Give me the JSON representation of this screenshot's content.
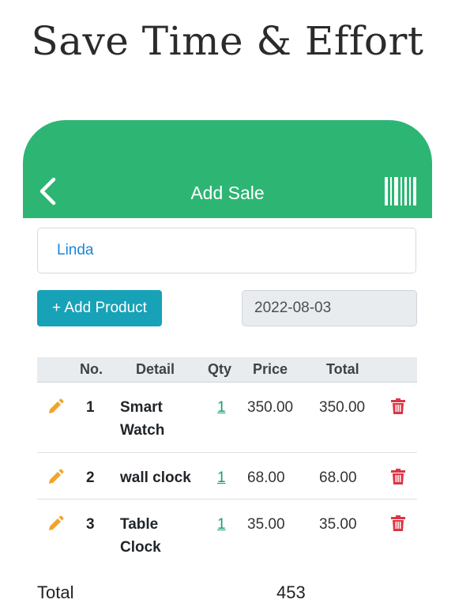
{
  "promo": {
    "headline": "Save Time & Effort"
  },
  "appbar": {
    "title": "Add Sale",
    "back_icon": "chevron-left-icon",
    "scan_icon": "barcode-icon",
    "color": "#2db574"
  },
  "form": {
    "customer": "Linda",
    "add_product_label": "+ Add Product",
    "date": "2022-08-03"
  },
  "table": {
    "headers": {
      "no": "No.",
      "detail": "Detail",
      "qty": "Qty",
      "price": "Price",
      "total": "Total"
    },
    "rows": [
      {
        "no": "1",
        "detail": "Smart Watch",
        "qty": "1",
        "price": "350.00",
        "total": "350.00"
      },
      {
        "no": "2",
        "detail": "wall clock",
        "qty": "1",
        "price": "68.00",
        "total": "68.00"
      },
      {
        "no": "3",
        "detail": "Table Clock",
        "qty": "1",
        "price": "35.00",
        "total": "35.00"
      }
    ],
    "edit_icon": "pencil-icon",
    "delete_icon": "trash-icon"
  },
  "summary": {
    "label": "Total",
    "value": "453"
  },
  "colors": {
    "accent": "#2db574",
    "button": "#17a2b8",
    "edit": "#f0a52a",
    "delete": "#dc3545",
    "customer_text": "#1a86d8"
  }
}
